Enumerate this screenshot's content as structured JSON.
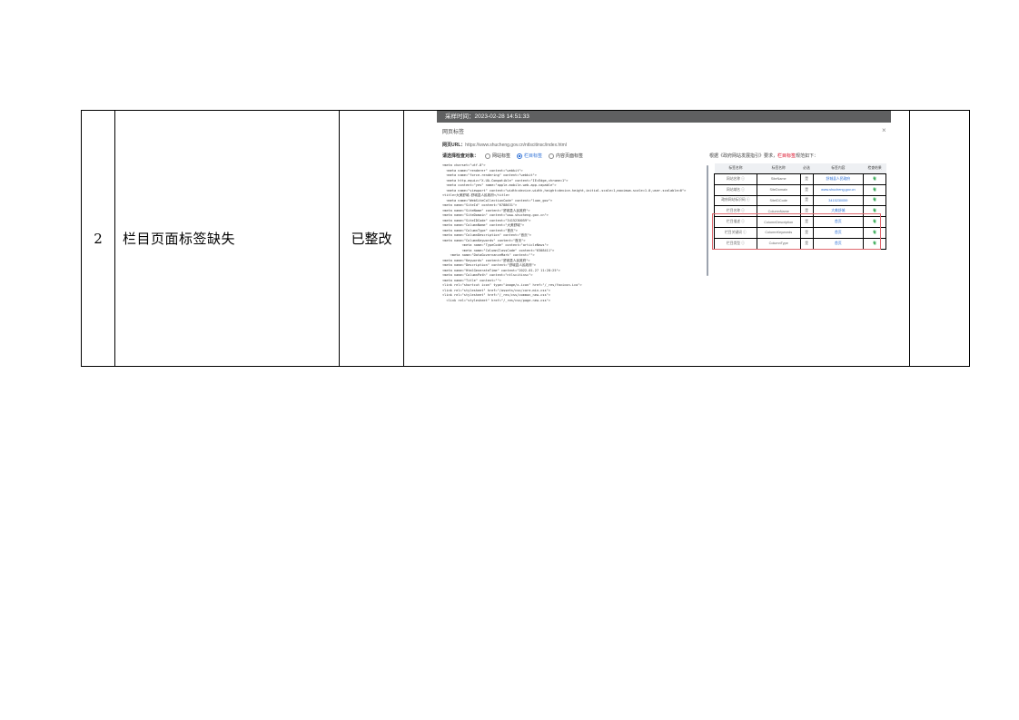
{
  "row": {
    "number": "2",
    "issue": "栏目页面标签缺失",
    "status": "已整改"
  },
  "screenshot": {
    "timestamp_bar": "采样时间：2023-02-28  14:51:33",
    "dialog_title": "网页标签",
    "close_label": "×",
    "url_label": "网页URL：",
    "url_value": "https://www.shucheng.gov.cn/ntlscitinsc/index.html",
    "select_label": "请选择检查对象：",
    "options": [
      "网站标签",
      "栏目标签",
      "内容页面标签"
    ],
    "selected_option": "栏目标签",
    "note_prefix": "根据《政府网站发展指引》要求，",
    "note_highlight": "栏目标签",
    "note_suffix": "规范如下：",
    "code_lines": [
      "<meta charset=\"utf-8\">",
      "  <meta name=\"renderer\" content=\"webkit\">",
      "  <meta name=\"force-rendering\" content=\"webkit\">",
      "  <meta http-equiv=\"X-UA-Compatible\" content=\"IE=Edge,chrome=1\">",
      "  <meta content=\"yes\" name=\"apple-mobile-web-app-capable\">",
      "  <meta name=\"viewport\" content=\"width=device-width,height=device-height,initial-scale=1,maximum-scale=1.0,user-scalable=0\">",
      "<title>大美舒城-舒城县人民政府</title>",
      "  <meta name=\"WebSiteCollectionCode\" content=\"luan_gov\">",
      "<meta name=\"SiteId\" content=\"6788631\">",
      "<meta name=\"SiteName\" content=\"舒城县人民政府\">",
      "<meta name=\"SiteDomain\" content=\"www.shucheng.gov.cn\">",
      "<meta name=\"SiteIDCode\" content=\"3415230059\">",
      "<meta name=\"ColumnName\" content=\"大美舒城\">",
      "<meta name=\"ColumnType\" content=\"首页\">",
      "<meta name=\"ColumnDescription\" content=\"首页\">",
      "<meta name=\"ColumnKeywords\" content=\"首页\">",
      "          <meta name=\"TypeCode\" content=\"articleNews\">",
      "          <meta name=\"ColumnClassCode\" content=\"6308411\">",
      "",
      "    <meta name=\"DataGovernanceMark\" content=\"\">",
      "<meta name=\"Keywords\" content=\"舒城县人民政府\">",
      "<meta name=\"Description\" content=\"舒城县人民政府\">",
      "<meta name=\"HtmlGenerateTime\" content=\"2022-01-27 11:28:25\">",
      "<meta name=\"ColumnPath\" content=\"ntlscitinsc\">",
      "<meta name=\"Title\" content=\"\">",
      "<link rel=\"shortcut icon\" type=\"image/x-icon\" href=\"/_res/favicon.ico\">",
      "<link rel=\"stylesheet\" href=\"/assets/css/core.min.css\">",
      "<link rel=\"stylesheet\" href=\"/_res/css/common_new.css\">",
      "  <link rel=\"stylesheet\" href=\"/_res/css/page-new.css\">"
    ],
    "tag_table": {
      "headers": [
        "标签名称",
        "标签名称",
        "必选",
        "标签内容",
        "检查结果"
      ],
      "rows": [
        [
          "网站名称 ⓘ",
          "SiteName",
          "是",
          "舒城县人民政府",
          "有"
        ],
        [
          "网站域名 ⓘ",
          "SiteDomain",
          "是",
          "www.shucheng.gov.cn",
          "有"
        ],
        [
          "政府网站标识码 ⓘ",
          "SiteIDCode",
          "是",
          "3415230059",
          "有"
        ],
        [
          "栏目名称 ⓘ",
          "ColumnName",
          "是",
          "大美舒城",
          "有"
        ],
        [
          "栏目描述 ⓘ",
          "ColumnDescription",
          "是",
          "首页",
          "有"
        ],
        [
          "栏目关键词 ⓘ",
          "ColumnKeywords",
          "是",
          "首页",
          "有"
        ],
        [
          "栏目类型 ⓘ",
          "ColumnType",
          "是",
          "首页",
          "有"
        ]
      ]
    }
  }
}
